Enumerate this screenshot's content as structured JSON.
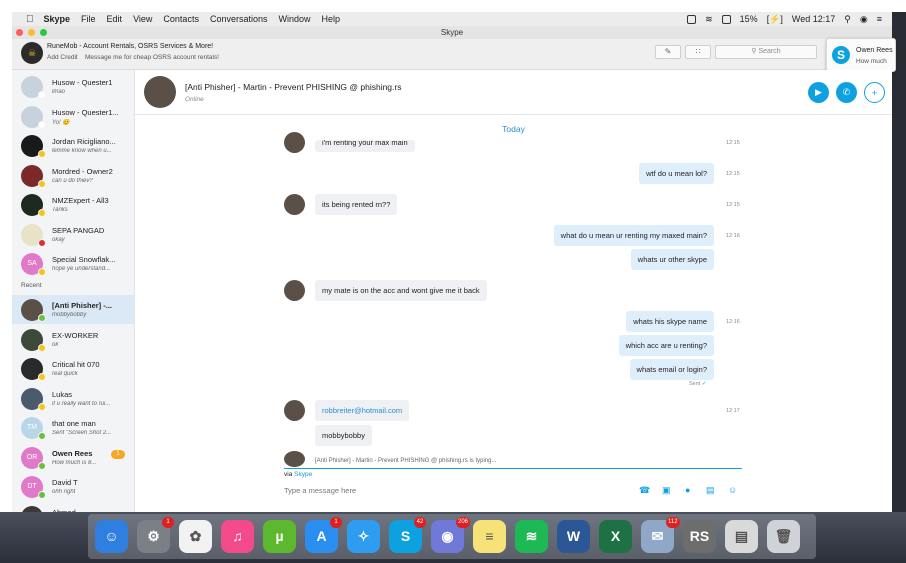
{
  "menubar": {
    "apple_icon": "apple-icon",
    "items": [
      "Skype",
      "File",
      "Edit",
      "View",
      "Contacts",
      "Conversations",
      "Window",
      "Help"
    ],
    "battery": "15%",
    "clock": "Wed 12:17"
  },
  "window": {
    "title": "Skype"
  },
  "profile": {
    "name": "RuneMob - Account Rentals, OSRS Services & More!",
    "add_credit": "Add Credit",
    "mood": "Message me for cheap OSRS account rentals!"
  },
  "search": {
    "placeholder": "Search"
  },
  "notification": {
    "title": "Owen Rees",
    "body": "How much"
  },
  "contacts": [
    {
      "name": "Husow - Quester1",
      "sub": "lmao",
      "color": "#c8d2dc",
      "status": "#ffffff"
    },
    {
      "name": "Husow - Quester1...",
      "sub": "Yo! 😊",
      "color": "#c8d2dc",
      "status": "#ffffff"
    },
    {
      "name": "Jordan Ricigliano...",
      "sub": "lemme know when u...",
      "color": "#1a1a1a",
      "status": "#f5c518"
    },
    {
      "name": "Mordred - Owner2",
      "sub": "can u do thiev?",
      "color": "#7a2a2a",
      "status": "#f5c518"
    },
    {
      "name": "NMZExpert - All3",
      "sub": "Tanks",
      "color": "#1e2a20",
      "status": "#f5c518"
    },
    {
      "name": "SEPA PANGAD",
      "sub": "okay",
      "color": "#e8e2c8",
      "status": "#e03030"
    },
    {
      "name": "Special Snowflak...",
      "sub": "hope ye understand...",
      "color": "#e07ac8",
      "initials": "SA",
      "status": "#f5c518"
    }
  ],
  "recent_label": "Recent",
  "recent": [
    {
      "name": "[Anti Phisher] -...",
      "sub": "mobbybobby",
      "color": "#5a5048",
      "status": "#6bbf3a",
      "bold": true
    },
    {
      "name": "EX-WORKER",
      "sub": "ok",
      "color": "#3c4a3a",
      "status": "#f5c518"
    },
    {
      "name": "Critical hit 070",
      "sub": "real quick",
      "color": "#2a2a2a",
      "status": "#f5c518"
    },
    {
      "name": "Lukas",
      "sub": "if u really want to rui...",
      "color": "#4a5a6a",
      "status": "#f5c518"
    },
    {
      "name": "that one man",
      "sub": "Sent \"Screen Shot 2...",
      "color": "#b9d6e8",
      "initials": "TM",
      "status": "#6bbf3a"
    },
    {
      "name": "Owen Rees",
      "sub": "How much is 8...",
      "color": "#e07ac8",
      "initials": "OR",
      "status": "#6bbf3a",
      "bold": true,
      "badge": "1"
    },
    {
      "name": "David T",
      "sub": "ohh right",
      "color": "#e07ac8",
      "initials": "DT",
      "status": "#6bbf3a"
    },
    {
      "name": "Ahmed",
      "sub": "",
      "color": "#3a3a3a",
      "status": "#6bbf3a"
    }
  ],
  "chat": {
    "title": "[Anti Phisher] - Martin - Prevent PHISHING @ phishing.rs",
    "status": "Online",
    "date": "Today",
    "messages": [
      {
        "text": "i'm renting your max main",
        "dir": "in",
        "time": "12:15"
      },
      {
        "text": "wtf do u mean lol?",
        "dir": "out",
        "time": "12:15"
      },
      {
        "text": "its being rented rn??",
        "dir": "in",
        "time": "12:15"
      },
      {
        "text": "what do u mean ur renting my maxed main?",
        "dir": "out",
        "time": "12:16"
      },
      {
        "text": "whats ur other skype",
        "dir": "out",
        "time": ""
      },
      {
        "text": "my mate is on the acc and wont give me it back",
        "dir": "in",
        "time": ""
      },
      {
        "text": "whats his skype name",
        "dir": "out",
        "time": "12:16"
      },
      {
        "text": "which acc are u renting?",
        "dir": "out",
        "time": ""
      },
      {
        "text": "whats email or login?",
        "dir": "out",
        "time": ""
      },
      {
        "text": "robbreiter@hotmail.com",
        "dir": "in",
        "time": "12:17"
      },
      {
        "text": "mobbybobby",
        "dir": "in",
        "time": ""
      }
    ],
    "sent_label": "Sent",
    "typing": "[Anti Phisher] - Martin - Prevent PHISHING @ phishing.rs is typing...",
    "via": "via",
    "via_app": "Skype",
    "input_placeholder": "Type a message here"
  },
  "dock": [
    {
      "name": "finder",
      "color": "#2f7fe0",
      "glyph": "☺"
    },
    {
      "name": "system-preferences",
      "color": "#7b7f86",
      "glyph": "⚙",
      "badge": "1"
    },
    {
      "name": "photos",
      "color": "#f2f2f2",
      "glyph": "✿"
    },
    {
      "name": "itunes",
      "color": "#f24a8a",
      "glyph": "♫"
    },
    {
      "name": "utorrent",
      "color": "#5cb82e",
      "glyph": "µ"
    },
    {
      "name": "app-store",
      "color": "#2a8ef0",
      "glyph": "A",
      "badge": "1"
    },
    {
      "name": "safari",
      "color": "#2e9cf0",
      "glyph": "✧"
    },
    {
      "name": "skype",
      "color": "#0ea1e0",
      "glyph": "S",
      "badge": "42"
    },
    {
      "name": "discord",
      "color": "#6f7ad8",
      "glyph": "◉",
      "badge": "206"
    },
    {
      "name": "notes",
      "color": "#f7e27a",
      "glyph": "≡"
    },
    {
      "name": "spotify",
      "color": "#1db954",
      "glyph": "≋"
    },
    {
      "name": "word",
      "color": "#2b5797",
      "glyph": "W"
    },
    {
      "name": "excel",
      "color": "#1e7145",
      "glyph": "X"
    },
    {
      "name": "preview",
      "color": "#8fa8c8",
      "glyph": "✉",
      "badge": "112"
    },
    {
      "name": "runescape",
      "color": "#6d6d6d",
      "glyph": "RS"
    },
    {
      "name": "documents",
      "color": "#d9d9d9",
      "glyph": "▤"
    },
    {
      "name": "trash",
      "color": "#cfd3d8",
      "glyph": "🗑"
    }
  ]
}
